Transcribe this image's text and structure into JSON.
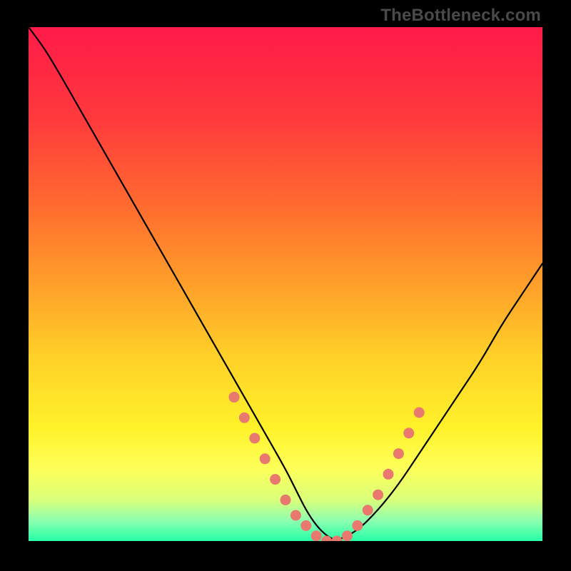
{
  "watermark": "TheBottleneck.com",
  "chart_data": {
    "type": "line",
    "title": "",
    "xlabel": "",
    "ylabel": "",
    "xlim": [
      0,
      100
    ],
    "ylim": [
      0,
      100
    ],
    "series": [
      {
        "name": "bottleneck-curve",
        "x": [
          0,
          3,
          6,
          10,
          14,
          18,
          22,
          26,
          30,
          34,
          38,
          42,
          46,
          50,
          52,
          54,
          56,
          58,
          60,
          64,
          68,
          72,
          76,
          80,
          84,
          88,
          92,
          96,
          100
        ],
        "y": [
          100,
          96,
          91,
          84,
          77,
          70,
          63,
          56,
          49,
          42,
          35,
          28,
          21,
          14,
          10,
          6,
          3,
          1,
          0,
          2,
          6,
          11,
          17,
          23,
          29,
          35,
          42,
          48,
          54
        ]
      }
    ],
    "markers": {
      "name": "highlight-dots",
      "x": [
        40,
        42,
        44,
        46,
        48,
        50,
        52,
        54,
        56,
        58,
        60,
        62,
        64,
        66,
        68,
        70,
        72,
        74,
        76
      ],
      "y": [
        28,
        24,
        20,
        16,
        12,
        8,
        5,
        3,
        1,
        0,
        0,
        1,
        3,
        6,
        9,
        13,
        17,
        21,
        25
      ]
    },
    "gradient": {
      "stops": [
        {
          "offset": 0.0,
          "color": "#ff1a49"
        },
        {
          "offset": 0.18,
          "color": "#ff3a3c"
        },
        {
          "offset": 0.35,
          "color": "#ff6c2f"
        },
        {
          "offset": 0.5,
          "color": "#ff9f2a"
        },
        {
          "offset": 0.64,
          "color": "#ffd028"
        },
        {
          "offset": 0.78,
          "color": "#fff22a"
        },
        {
          "offset": 0.86,
          "color": "#fdff5a"
        },
        {
          "offset": 0.92,
          "color": "#d9ff7a"
        },
        {
          "offset": 0.96,
          "color": "#8dffB0"
        },
        {
          "offset": 1.0,
          "color": "#25ffa7"
        }
      ]
    }
  }
}
